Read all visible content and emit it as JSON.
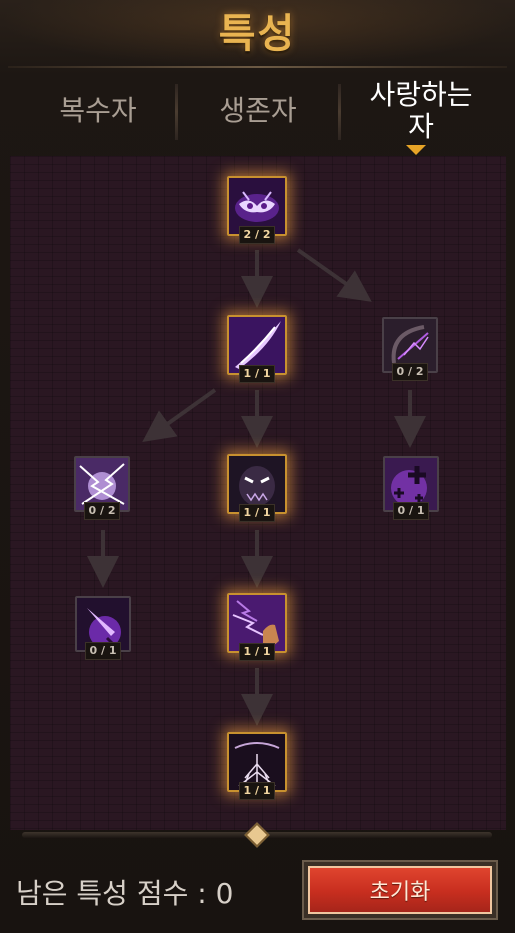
{
  "title": "특성",
  "tabs": [
    {
      "label": "복수자"
    },
    {
      "label": "생존자"
    },
    {
      "label": "사랑하는\n자"
    }
  ],
  "active_tab": "사랑하는 자",
  "nodes": [
    {
      "count": "2 / 2",
      "icon": "demon-mask-icon"
    },
    {
      "count": "1 / 1",
      "icon": "void-slash-icon"
    },
    {
      "count": "0 / 2",
      "icon": "shadow-bow-icon"
    },
    {
      "count": "0 / 2",
      "icon": "chain-lightning-icon"
    },
    {
      "count": "1 / 1",
      "icon": "shadow-face-icon"
    },
    {
      "count": "0 / 1",
      "icon": "purple-plus-icon"
    },
    {
      "count": "0 / 1",
      "icon": "arcane-dagger-icon"
    },
    {
      "count": "1 / 1",
      "icon": "lightning-hand-icon"
    },
    {
      "count": "1 / 1",
      "icon": "root-tree-icon"
    }
  ],
  "points_label": "남은 특성 점수 : 0",
  "reset_label": "초기화",
  "colors": {
    "accent": "#e9b451",
    "panel": "#2a1722",
    "button": "#c72e1f"
  }
}
